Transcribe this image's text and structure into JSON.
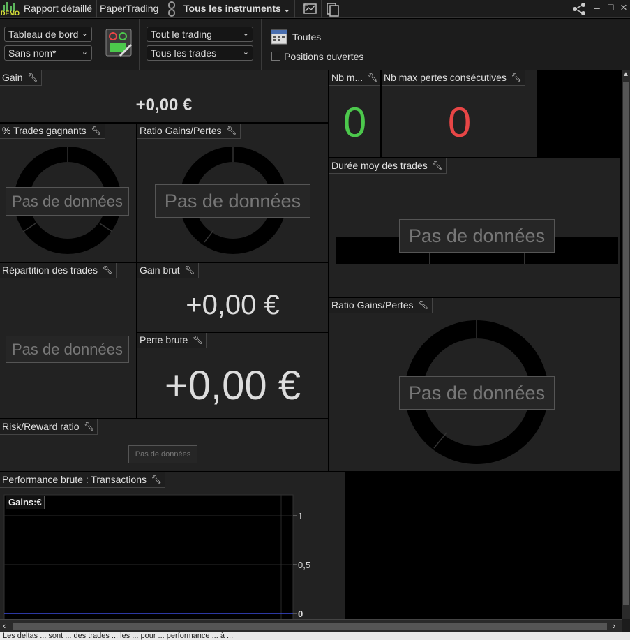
{
  "titlebar": {
    "logo_text": "DEMO",
    "tabs": [
      "Rapport détaillé",
      "PaperTrading",
      "Tous les instruments"
    ],
    "link_icon": "link-icon",
    "add_chart_icon": "add-chart-icon",
    "documents_icon": "documents-icon",
    "share_icon": "share-icon",
    "minimize": "–",
    "maximize": "□",
    "close": "×"
  },
  "toolbar": {
    "dashboard_select": "Tableau de bord",
    "name_select": "Sans nom*",
    "trading_select": "Tout le trading",
    "trades_select": "Tous les trades",
    "period_label": "Toutes",
    "open_positions_label": "Positions ouvertes",
    "open_positions_checked": false
  },
  "panels": {
    "gain": {
      "title": "Gain",
      "value": "+0,00 €"
    },
    "pct_winning": {
      "title": "% Trades gagnants",
      "nodata": "Pas de données"
    },
    "ratio_gp_small": {
      "title": "Ratio Gains/Pertes",
      "nodata": "Pas de données"
    },
    "nb_max_gains": {
      "title": "Nb m...",
      "value": "0"
    },
    "nb_max_losses": {
      "title": "Nb max pertes consécutives",
      "value": "0"
    },
    "avg_duration": {
      "title": "Durée moy des trades",
      "nodata": "Pas de données"
    },
    "trade_distribution": {
      "title": "Répartition des trades",
      "nodata": "Pas de données"
    },
    "gross_gain": {
      "title": "Gain brut",
      "value": "+0,00 €"
    },
    "gross_loss": {
      "title": "Perte brute",
      "value": "+0,00 €"
    },
    "ratio_gp_large": {
      "title": "Ratio Gains/Pertes",
      "nodata": "Pas de données"
    },
    "risk_reward": {
      "title": "Risk/Reward ratio",
      "nodata": "Pas de données"
    },
    "performance": {
      "title": "Performance brute : Transactions",
      "legend": "Gains:€"
    }
  },
  "chart_data": {
    "type": "line",
    "title": "",
    "series": [
      {
        "name": "Gains:€",
        "x": [
          0,
          1
        ],
        "y": [
          0,
          0
        ]
      }
    ],
    "ylim": [
      0,
      1.1
    ],
    "yticks": [
      "1",
      "0,5",
      "0"
    ],
    "ytick_values": [
      1,
      0.5,
      0
    ],
    "grid": true,
    "colors": {
      "line": "#3b4bd8",
      "grid": "#2a2a2a"
    }
  },
  "status": {
    "text": "Les deltas ... sont ... des trades ... les ... pour ... performance ... à ... "
  },
  "colors": {
    "green": "#4cc84c",
    "red": "#e84646",
    "panel": "#222222"
  }
}
